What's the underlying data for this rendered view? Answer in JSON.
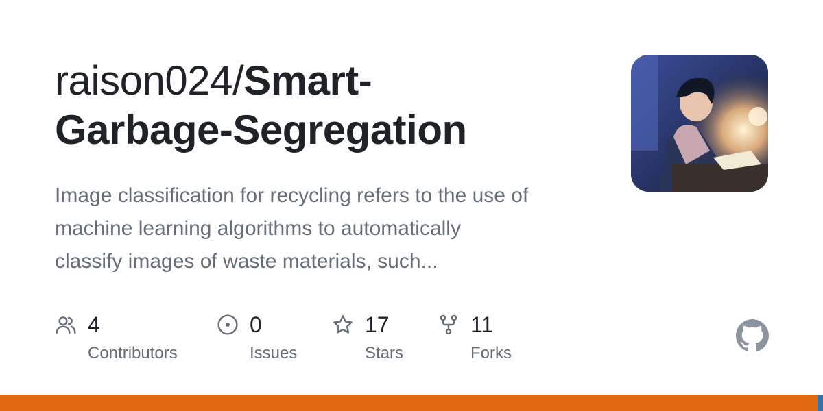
{
  "repo": {
    "owner": "raison024/",
    "name_line1": "Smart-",
    "name_line2": "Garbage-Segregation",
    "description_line1": "Image classification for recycling refers to the use of",
    "description_line2": "machine learning algorithms to automatically",
    "description_line3": "classify images of waste materials, such..."
  },
  "stats": [
    {
      "count": "4",
      "label": "Contributors",
      "icon": "people-icon"
    },
    {
      "count": "0",
      "label": "Issues",
      "icon": "issue-opened-icon"
    },
    {
      "count": "17",
      "label": "Stars",
      "icon": "star-icon"
    },
    {
      "count": "11",
      "label": "Forks",
      "icon": "repo-forked-icon"
    }
  ],
  "colors": {
    "language_bar_primary": "#e06a10",
    "language_bar_secondary": "#3572a5",
    "text_primary": "#1f2328",
    "text_secondary": "#656d76"
  }
}
